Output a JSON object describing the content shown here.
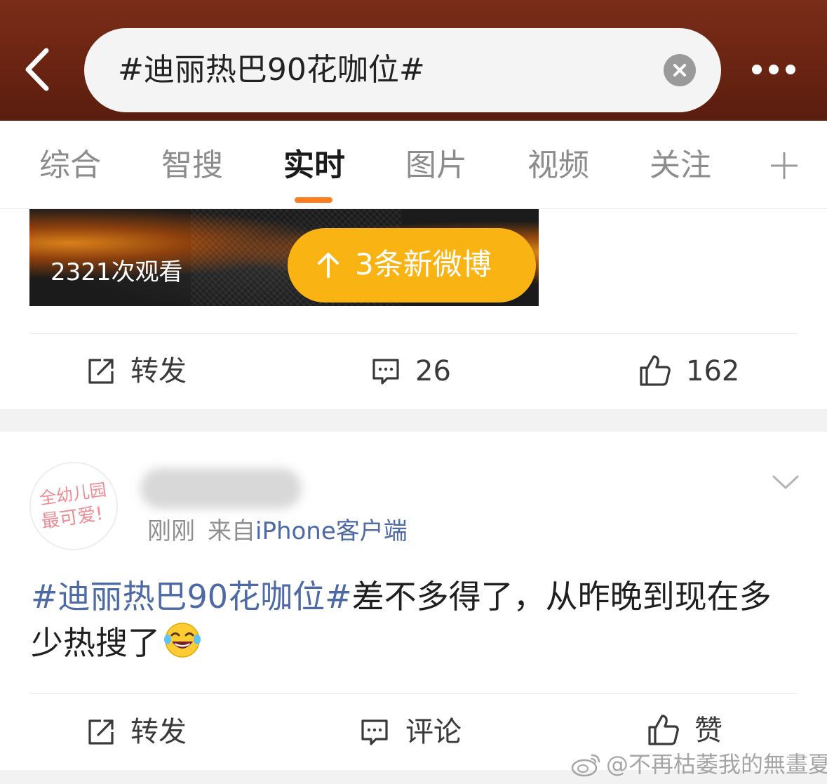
{
  "header": {
    "search_query": "#迪丽热巴90花咖位#"
  },
  "tabs": [
    {
      "label": "综合"
    },
    {
      "label": "智搜"
    },
    {
      "label": "实时"
    },
    {
      "label": "图片"
    },
    {
      "label": "视频"
    },
    {
      "label": "关注"
    }
  ],
  "active_tab": "实时",
  "icons": {
    "back": "chevron-left-icon",
    "clear": "close-circle-icon",
    "more": "more-dots-icon",
    "add_tab": "plus-icon",
    "new_posts": "arrow-up-icon",
    "repost": "share-square-icon",
    "comment": "comment-bubble-icon",
    "like": "thumbs-up-icon",
    "post_menu": "chevron-down-icon",
    "emoji": "laughing-tears-emoji",
    "watermark": "weibo-logo-icon"
  },
  "colors": {
    "header_bg": "#6a2412",
    "accent": "#ff7e22",
    "new_posts_pill": "#f9b313",
    "link_blue": "#4d6aa6"
  },
  "card1": {
    "view_count": "2321次观看",
    "new_posts_label": "3条新微博",
    "repost_label": "转发",
    "comment_count": "26",
    "like_count": "162"
  },
  "card2": {
    "avatar_text_line1": "全幼儿园",
    "avatar_text_line2": "最可爱!",
    "time": "刚刚",
    "source_prefix": "来自",
    "source_client": "iPhone客户端",
    "topic": "#迪丽热巴90花咖位#",
    "body": "差不多得了，从昨晚到现在多少热搜了",
    "repost_label": "转发",
    "comment_label": "评论",
    "like_label": "赞"
  },
  "watermark": {
    "text": "@不再枯萎我的無畫夏"
  }
}
